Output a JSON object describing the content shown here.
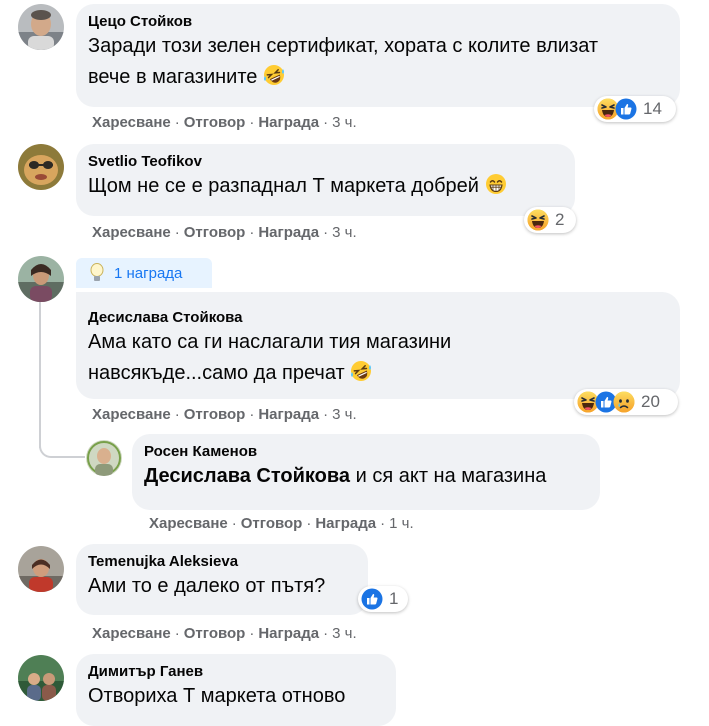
{
  "comments": [
    {
      "author": "Цецо Стойков",
      "text_line1": "Заради този зелен сертификат, хората с колите влизат",
      "text_line2": "вече в магазините",
      "emoji": "laughing-rolling-emoji",
      "reaction_icons": [
        "haha-reaction-icon",
        "like-reaction-icon"
      ],
      "reaction_count": "14",
      "actions": {
        "like": "Харесване",
        "reply": "Отговор",
        "award": "Награда",
        "time": "3 ч."
      }
    },
    {
      "author": "Svetlio Teofikov",
      "text_line1": "Щом не се е разпаднал Т маркета добрей",
      "emoji": "grinning-emoji",
      "reaction_icons": [
        "haha-reaction-icon"
      ],
      "reaction_count": "2",
      "actions": {
        "like": "Харесване",
        "reply": "Отговор",
        "award": "Награда",
        "time": "3 ч."
      }
    },
    {
      "award_badge": "1 награда",
      "author": "Десислава Стойкова",
      "text_line1": "Ама като са ги наслагали тия магазини",
      "text_line2": "навсякъде...само да пречат",
      "emoji": "laughing-rolling-emoji",
      "reaction_icons": [
        "haha-reaction-icon",
        "like-reaction-icon",
        "sad-reaction-icon"
      ],
      "reaction_count": "20",
      "actions": {
        "like": "Харесване",
        "reply": "Отговор",
        "award": "Награда",
        "time": "3 ч."
      }
    },
    {
      "author": "Росен Каменов",
      "mention": "Десислава Стойкова",
      "text_after_mention": " и ся акт на магазина",
      "actions": {
        "like": "Харесване",
        "reply": "Отговор",
        "award": "Награда",
        "time": "1 ч."
      }
    },
    {
      "author": "Temenujka Aleksieva",
      "text_line1": "Ами то е далеко от пътя?",
      "reaction_icons": [
        "like-reaction-icon"
      ],
      "reaction_count": "1",
      "actions": {
        "like": "Харесване",
        "reply": "Отговор",
        "award": "Награда",
        "time": "3 ч."
      }
    },
    {
      "author": "Димитър Ганев",
      "text_line1": "Отвориха Т маркета отново"
    }
  ],
  "colors": {
    "bubble": "#f0f2f5",
    "muted": "#65676b",
    "link": "#1877f2",
    "award_bg": "#e7f3ff"
  }
}
